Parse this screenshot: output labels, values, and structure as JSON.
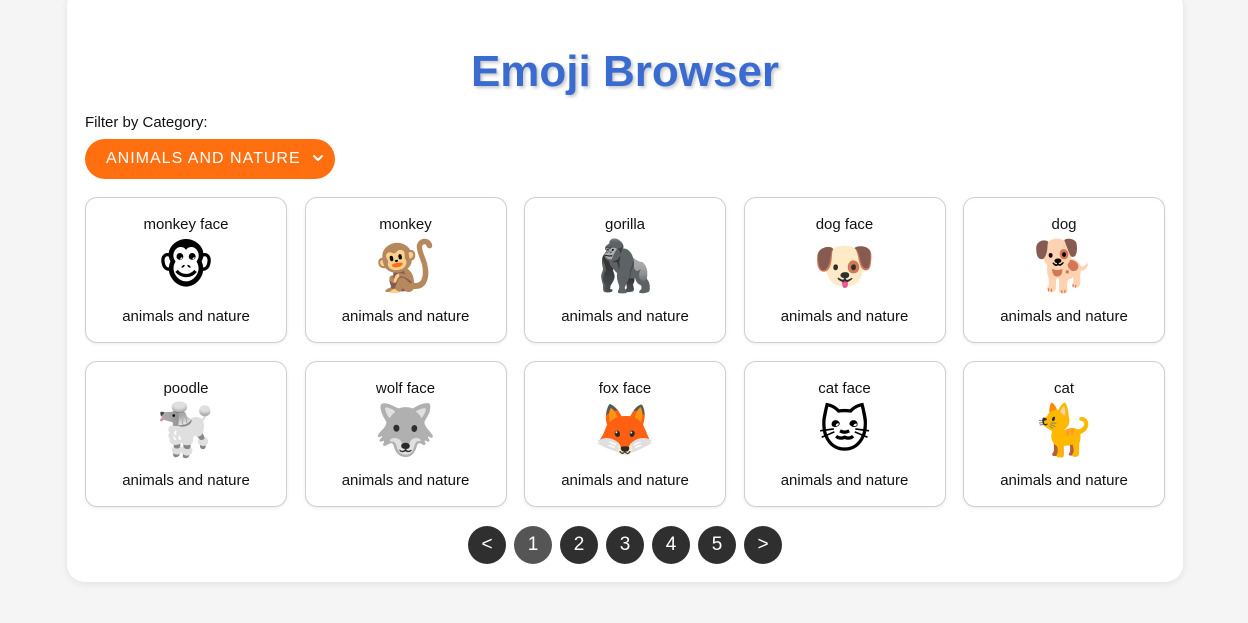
{
  "title": "Emoji Browser",
  "filter": {
    "label": "Filter by Category:",
    "selected": "ANIMALS AND NATURE"
  },
  "cards": [
    {
      "name": "monkey face",
      "emoji": "🐵",
      "category": "animals and nature"
    },
    {
      "name": "monkey",
      "emoji": "🐒",
      "category": "animals and nature"
    },
    {
      "name": "gorilla",
      "emoji": "🦍",
      "category": "animals and nature"
    },
    {
      "name": "dog face",
      "emoji": "🐶",
      "category": "animals and nature"
    },
    {
      "name": "dog",
      "emoji": "🐕",
      "category": "animals and nature"
    },
    {
      "name": "poodle",
      "emoji": "🐩",
      "category": "animals and nature"
    },
    {
      "name": "wolf face",
      "emoji": "🐺",
      "category": "animals and nature"
    },
    {
      "name": "fox face",
      "emoji": "🦊",
      "category": "animals and nature"
    },
    {
      "name": "cat face",
      "emoji": "🐱",
      "category": "animals and nature"
    },
    {
      "name": "cat",
      "emoji": "🐈",
      "category": "animals and nature"
    }
  ],
  "pagination": {
    "prev": "<",
    "next": ">",
    "pages": [
      "1",
      "2",
      "3",
      "4",
      "5"
    ],
    "current": "1"
  },
  "colors": {
    "title": "#3a6bd0",
    "select_bg": "#ff6f0f",
    "pager_bg": "#2f2f2f",
    "pager_active": "#555555"
  }
}
